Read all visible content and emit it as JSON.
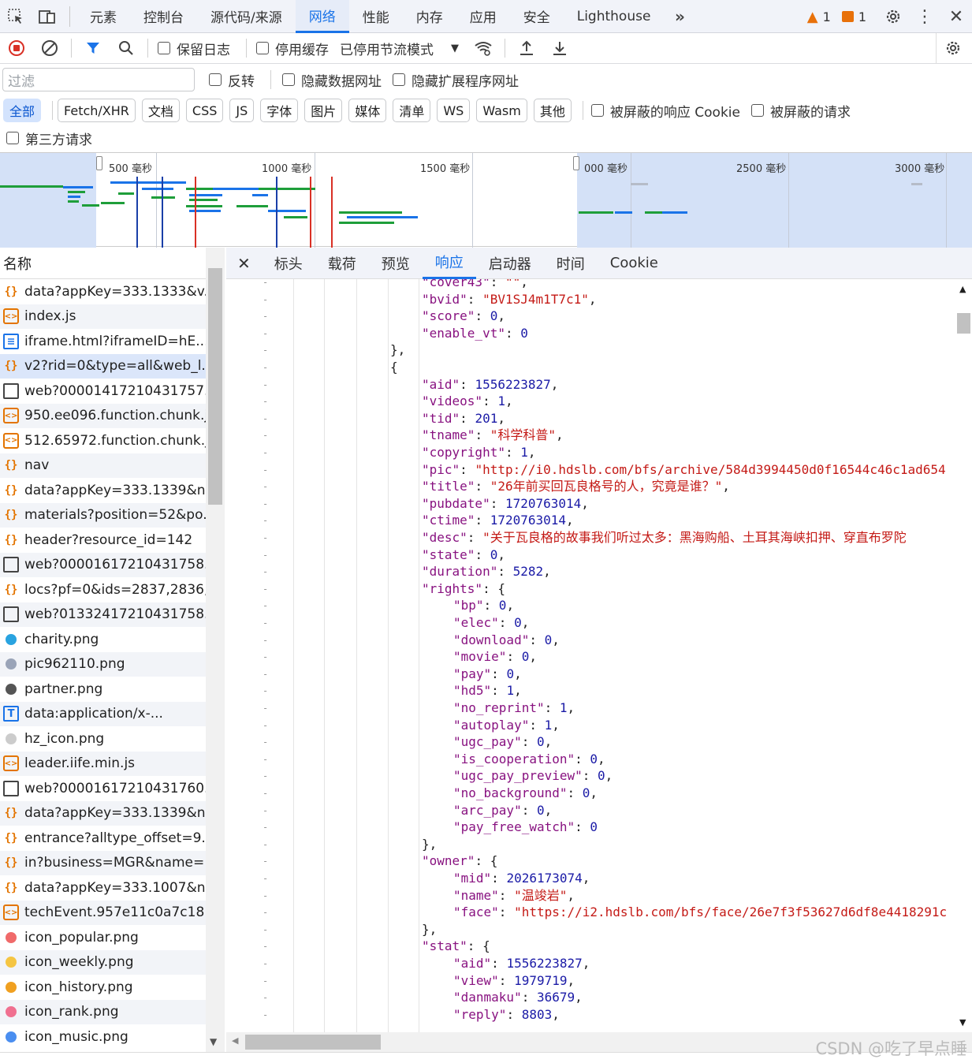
{
  "topbar": {
    "tabs": [
      "元素",
      "控制台",
      "源代码/来源",
      "网络",
      "性能",
      "内存",
      "应用",
      "安全",
      "Lighthouse"
    ],
    "active_tab": "网络",
    "warning_count": "1",
    "issue_count": "1"
  },
  "toolbar": {
    "preserve_log": "保留日志",
    "disable_cache": "停用缓存",
    "throttle": "已停用节流模式"
  },
  "filter": {
    "placeholder": "过滤",
    "invert": "反转",
    "hide_data_urls": "隐藏数据网址",
    "hide_ext_urls": "隐藏扩展程序网址"
  },
  "types": [
    "全部",
    "Fetch/XHR",
    "文档",
    "CSS",
    "JS",
    "字体",
    "图片",
    "媒体",
    "清单",
    "WS",
    "Wasm",
    "其他"
  ],
  "blocked_cookies": "被屏蔽的响应 Cookie",
  "blocked_requests": "被屏蔽的请求",
  "third_party": "第三方请求",
  "timeline": {
    "labels": [
      "500 毫秒",
      "1000 毫秒",
      "1500 毫秒",
      "000 毫秒",
      "2500 毫秒",
      "3000 毫秒"
    ]
  },
  "list": {
    "header": "名称",
    "rows": [
      {
        "type": "xhr",
        "name": "data?appKey=333.1333&v..."
      },
      {
        "type": "js",
        "name": "index.js"
      },
      {
        "type": "doc",
        "name": "iframe.html?iframeID=hE..."
      },
      {
        "type": "xhr",
        "name": "v2?rid=0&type=all&web_l...",
        "selected": true
      },
      {
        "type": "other",
        "name": "web?00001417210431757..."
      },
      {
        "type": "js",
        "name": "950.ee096.function.chunk.js"
      },
      {
        "type": "js",
        "name": "512.65972.function.chunk.js"
      },
      {
        "type": "xhr",
        "name": "nav"
      },
      {
        "type": "xhr",
        "name": "data?appKey=333.1339&n..."
      },
      {
        "type": "xhr",
        "name": "materials?position=52&po..."
      },
      {
        "type": "xhr",
        "name": "header?resource_id=142"
      },
      {
        "type": "other",
        "name": "web?00001617210431758..."
      },
      {
        "type": "xhr",
        "name": "locs?pf=0&ids=2837,2836,..."
      },
      {
        "type": "other",
        "name": "web?01332417210431758..."
      },
      {
        "type": "img",
        "color": "#29a3e0",
        "name": "charity.png"
      },
      {
        "type": "img",
        "color": "#9aa4b8",
        "name": "pic962110.png"
      },
      {
        "type": "img",
        "color": "#555555",
        "name": "partner.png"
      },
      {
        "type": "font",
        "name": "data:application/x-..."
      },
      {
        "type": "img",
        "color": "#cccccc",
        "name": "hz_icon.png"
      },
      {
        "type": "js",
        "name": "leader.iife.min.js"
      },
      {
        "type": "other",
        "name": "web?00001617210431760..."
      },
      {
        "type": "xhr",
        "name": "data?appKey=333.1339&n..."
      },
      {
        "type": "xhr",
        "name": "entrance?alltype_offset=9..."
      },
      {
        "type": "xhr",
        "name": "in?business=MGR&name=..."
      },
      {
        "type": "xhr",
        "name": "data?appKey=333.1007&n..."
      },
      {
        "type": "js",
        "name": "techEvent.957e11c0a7c18..."
      },
      {
        "type": "img",
        "color": "#f06a6a",
        "name": "icon_popular.png"
      },
      {
        "type": "img",
        "color": "#f5c542",
        "name": "icon_weekly.png"
      },
      {
        "type": "img",
        "color": "#f0a020",
        "name": "icon_history.png"
      },
      {
        "type": "img",
        "color": "#f07090",
        "name": "icon_rank.png"
      },
      {
        "type": "img",
        "color": "#4a8ef0",
        "name": "icon_music.png"
      }
    ]
  },
  "detail_tabs": [
    "标头",
    "载荷",
    "预览",
    "响应",
    "启动器",
    "时间",
    "Cookie"
  ],
  "detail_active": "响应",
  "code_lines": [
    {
      "indent": 2,
      "parts": [
        [
          "k",
          "\"cover43\""
        ],
        [
          "p",
          ": "
        ],
        [
          "s",
          "\"\""
        ],
        [
          "p",
          ","
        ]
      ]
    },
    {
      "indent": 2,
      "parts": [
        [
          "k",
          "\"bvid\""
        ],
        [
          "p",
          ": "
        ],
        [
          "s",
          "\"BV1SJ4m1T7c1\""
        ],
        [
          "p",
          ","
        ]
      ]
    },
    {
      "indent": 2,
      "parts": [
        [
          "k",
          "\"score\""
        ],
        [
          "p",
          ": "
        ],
        [
          "n",
          "0"
        ],
        [
          "p",
          ","
        ]
      ]
    },
    {
      "indent": 2,
      "parts": [
        [
          "k",
          "\"enable_vt\""
        ],
        [
          "p",
          ": "
        ],
        [
          "n",
          "0"
        ]
      ]
    },
    {
      "indent": 1,
      "parts": [
        [
          "p",
          "},"
        ]
      ]
    },
    {
      "indent": 1,
      "parts": [
        [
          "p",
          "{"
        ]
      ]
    },
    {
      "indent": 2,
      "parts": [
        [
          "k",
          "\"aid\""
        ],
        [
          "p",
          ": "
        ],
        [
          "n",
          "1556223827"
        ],
        [
          "p",
          ","
        ]
      ]
    },
    {
      "indent": 2,
      "parts": [
        [
          "k",
          "\"videos\""
        ],
        [
          "p",
          ": "
        ],
        [
          "n",
          "1"
        ],
        [
          "p",
          ","
        ]
      ]
    },
    {
      "indent": 2,
      "parts": [
        [
          "k",
          "\"tid\""
        ],
        [
          "p",
          ": "
        ],
        [
          "n",
          "201"
        ],
        [
          "p",
          ","
        ]
      ]
    },
    {
      "indent": 2,
      "parts": [
        [
          "k",
          "\"tname\""
        ],
        [
          "p",
          ": "
        ],
        [
          "s",
          "\"科学科普\""
        ],
        [
          "p",
          ","
        ]
      ]
    },
    {
      "indent": 2,
      "parts": [
        [
          "k",
          "\"copyright\""
        ],
        [
          "p",
          ": "
        ],
        [
          "n",
          "1"
        ],
        [
          "p",
          ","
        ]
      ]
    },
    {
      "indent": 2,
      "parts": [
        [
          "k",
          "\"pic\""
        ],
        [
          "p",
          ": "
        ],
        [
          "s",
          "\"http://i0.hdslb.com/bfs/archive/584d3994450d0f16544c46c1ad654"
        ]
      ]
    },
    {
      "indent": 2,
      "parts": [
        [
          "k",
          "\"title\""
        ],
        [
          "p",
          ": "
        ],
        [
          "s",
          "\"26年前买回瓦良格号的人，究竟是谁？\""
        ],
        [
          "p",
          ","
        ]
      ]
    },
    {
      "indent": 2,
      "parts": [
        [
          "k",
          "\"pubdate\""
        ],
        [
          "p",
          ": "
        ],
        [
          "n",
          "1720763014"
        ],
        [
          "p",
          ","
        ]
      ]
    },
    {
      "indent": 2,
      "parts": [
        [
          "k",
          "\"ctime\""
        ],
        [
          "p",
          ": "
        ],
        [
          "n",
          "1720763014"
        ],
        [
          "p",
          ","
        ]
      ]
    },
    {
      "indent": 2,
      "parts": [
        [
          "k",
          "\"desc\""
        ],
        [
          "p",
          ": "
        ],
        [
          "s",
          "\"关于瓦良格的故事我们听过太多：黑海购船、土耳其海峡扣押、穿直布罗陀"
        ]
      ]
    },
    {
      "indent": 2,
      "parts": [
        [
          "k",
          "\"state\""
        ],
        [
          "p",
          ": "
        ],
        [
          "n",
          "0"
        ],
        [
          "p",
          ","
        ]
      ]
    },
    {
      "indent": 2,
      "parts": [
        [
          "k",
          "\"duration\""
        ],
        [
          "p",
          ": "
        ],
        [
          "n",
          "5282"
        ],
        [
          "p",
          ","
        ]
      ]
    },
    {
      "indent": 2,
      "parts": [
        [
          "k",
          "\"rights\""
        ],
        [
          "p",
          ": {"
        ]
      ]
    },
    {
      "indent": 3,
      "parts": [
        [
          "k",
          "\"bp\""
        ],
        [
          "p",
          ": "
        ],
        [
          "n",
          "0"
        ],
        [
          "p",
          ","
        ]
      ]
    },
    {
      "indent": 3,
      "parts": [
        [
          "k",
          "\"elec\""
        ],
        [
          "p",
          ": "
        ],
        [
          "n",
          "0"
        ],
        [
          "p",
          ","
        ]
      ]
    },
    {
      "indent": 3,
      "parts": [
        [
          "k",
          "\"download\""
        ],
        [
          "p",
          ": "
        ],
        [
          "n",
          "0"
        ],
        [
          "p",
          ","
        ]
      ]
    },
    {
      "indent": 3,
      "parts": [
        [
          "k",
          "\"movie\""
        ],
        [
          "p",
          ": "
        ],
        [
          "n",
          "0"
        ],
        [
          "p",
          ","
        ]
      ]
    },
    {
      "indent": 3,
      "parts": [
        [
          "k",
          "\"pay\""
        ],
        [
          "p",
          ": "
        ],
        [
          "n",
          "0"
        ],
        [
          "p",
          ","
        ]
      ]
    },
    {
      "indent": 3,
      "parts": [
        [
          "k",
          "\"hd5\""
        ],
        [
          "p",
          ": "
        ],
        [
          "n",
          "1"
        ],
        [
          "p",
          ","
        ]
      ]
    },
    {
      "indent": 3,
      "parts": [
        [
          "k",
          "\"no_reprint\""
        ],
        [
          "p",
          ": "
        ],
        [
          "n",
          "1"
        ],
        [
          "p",
          ","
        ]
      ]
    },
    {
      "indent": 3,
      "parts": [
        [
          "k",
          "\"autoplay\""
        ],
        [
          "p",
          ": "
        ],
        [
          "n",
          "1"
        ],
        [
          "p",
          ","
        ]
      ]
    },
    {
      "indent": 3,
      "parts": [
        [
          "k",
          "\"ugc_pay\""
        ],
        [
          "p",
          ": "
        ],
        [
          "n",
          "0"
        ],
        [
          "p",
          ","
        ]
      ]
    },
    {
      "indent": 3,
      "parts": [
        [
          "k",
          "\"is_cooperation\""
        ],
        [
          "p",
          ": "
        ],
        [
          "n",
          "0"
        ],
        [
          "p",
          ","
        ]
      ]
    },
    {
      "indent": 3,
      "parts": [
        [
          "k",
          "\"ugc_pay_preview\""
        ],
        [
          "p",
          ": "
        ],
        [
          "n",
          "0"
        ],
        [
          "p",
          ","
        ]
      ]
    },
    {
      "indent": 3,
      "parts": [
        [
          "k",
          "\"no_background\""
        ],
        [
          "p",
          ": "
        ],
        [
          "n",
          "0"
        ],
        [
          "p",
          ","
        ]
      ]
    },
    {
      "indent": 3,
      "parts": [
        [
          "k",
          "\"arc_pay\""
        ],
        [
          "p",
          ": "
        ],
        [
          "n",
          "0"
        ],
        [
          "p",
          ","
        ]
      ]
    },
    {
      "indent": 3,
      "parts": [
        [
          "k",
          "\"pay_free_watch\""
        ],
        [
          "p",
          ": "
        ],
        [
          "n",
          "0"
        ]
      ]
    },
    {
      "indent": 2,
      "parts": [
        [
          "p",
          "},"
        ]
      ]
    },
    {
      "indent": 2,
      "parts": [
        [
          "k",
          "\"owner\""
        ],
        [
          "p",
          ": {"
        ]
      ]
    },
    {
      "indent": 3,
      "parts": [
        [
          "k",
          "\"mid\""
        ],
        [
          "p",
          ": "
        ],
        [
          "n",
          "2026173074"
        ],
        [
          "p",
          ","
        ]
      ]
    },
    {
      "indent": 3,
      "parts": [
        [
          "k",
          "\"name\""
        ],
        [
          "p",
          ": "
        ],
        [
          "s",
          "\"温竣岩\""
        ],
        [
          "p",
          ","
        ]
      ]
    },
    {
      "indent": 3,
      "parts": [
        [
          "k",
          "\"face\""
        ],
        [
          "p",
          ": "
        ],
        [
          "s",
          "\"https://i2.hdslb.com/bfs/face/26e7f3f53627d6df8e4418291c"
        ]
      ]
    },
    {
      "indent": 2,
      "parts": [
        [
          "p",
          "},"
        ]
      ]
    },
    {
      "indent": 2,
      "parts": [
        [
          "k",
          "\"stat\""
        ],
        [
          "p",
          ": {"
        ]
      ]
    },
    {
      "indent": 3,
      "parts": [
        [
          "k",
          "\"aid\""
        ],
        [
          "p",
          ": "
        ],
        [
          "n",
          "1556223827"
        ],
        [
          "p",
          ","
        ]
      ]
    },
    {
      "indent": 3,
      "parts": [
        [
          "k",
          "\"view\""
        ],
        [
          "p",
          ": "
        ],
        [
          "n",
          "1979719"
        ],
        [
          "p",
          ","
        ]
      ]
    },
    {
      "indent": 3,
      "parts": [
        [
          "k",
          "\"danmaku\""
        ],
        [
          "p",
          ": "
        ],
        [
          "n",
          "36679"
        ],
        [
          "p",
          ","
        ]
      ]
    },
    {
      "indent": 3,
      "parts": [
        [
          "k",
          "\"reply\""
        ],
        [
          "p",
          ": "
        ],
        [
          "n",
          "8803"
        ],
        [
          "p",
          ","
        ]
      ]
    }
  ],
  "watermark": "CSDN @吃了早点睡"
}
